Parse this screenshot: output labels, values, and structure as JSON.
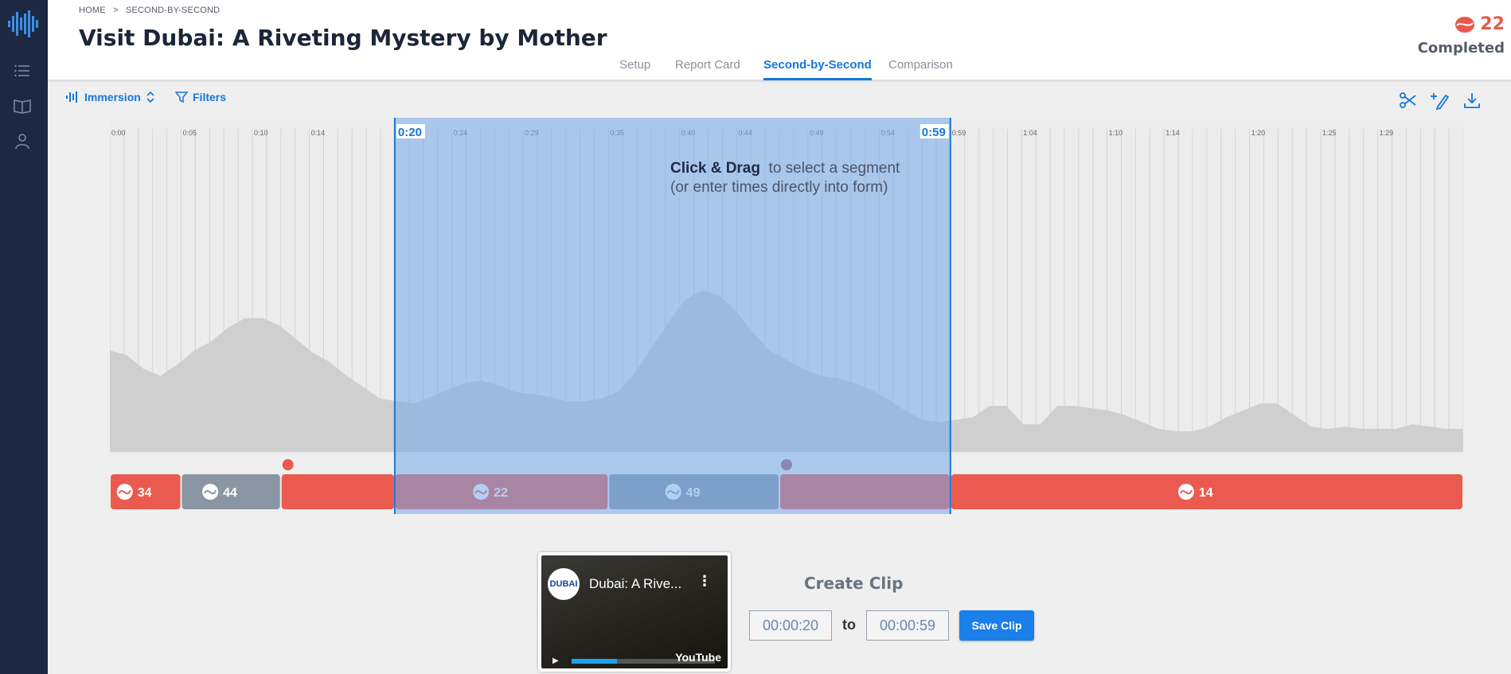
{
  "breadcrumb": {
    "home": "HOME",
    "sep": ">",
    "current": "SECOND-BY-SECOND"
  },
  "title": "Visit Dubai: A Riveting Mystery by Mother",
  "tabs": [
    {
      "label": "Setup"
    },
    {
      "label": "Report Card"
    },
    {
      "label": "Second-by-Second"
    },
    {
      "label": "Comparison"
    }
  ],
  "completed": {
    "count": "22",
    "label": "Completed"
  },
  "toolbar": {
    "mode_label": "Immersion",
    "filters_label": "Filters"
  },
  "timeline": {
    "ticks": [
      "0:00",
      "0:05",
      "0:10",
      "0:14",
      "0:20",
      "0:24",
      "0:29",
      "0:35",
      "0:40",
      "0:44",
      "0:49",
      "0:54",
      "0:59",
      "1:04",
      "1:10",
      "1:14",
      "1:20",
      "1:25",
      "1:29"
    ],
    "selection_start": "0:20",
    "selection_end": "0:59",
    "hint_bold": "Click & Drag",
    "hint_rest": "to select a segment",
    "hint_line2": "(or enter times directly into form)"
  },
  "chart_data": {
    "type": "area",
    "x_unit": "seconds",
    "xlim": [
      0,
      95
    ],
    "ylim": [
      0,
      100
    ],
    "values": [
      44,
      42,
      36,
      33,
      38,
      44,
      48,
      54,
      58,
      58,
      55,
      49,
      43,
      39,
      33,
      28,
      23,
      22,
      21,
      24,
      27,
      30,
      31,
      29,
      26,
      25,
      24,
      22,
      22,
      23,
      26,
      34,
      45,
      56,
      66,
      70,
      68,
      61,
      52,
      44,
      40,
      36,
      33,
      32,
      30,
      27,
      23,
      18,
      14,
      13,
      14,
      15,
      20,
      20,
      12,
      12,
      20,
      20,
      19,
      18,
      16,
      13,
      10,
      9,
      9,
      11,
      15,
      18,
      21,
      21,
      16,
      11,
      10,
      11,
      10,
      10,
      10,
      12,
      11,
      10,
      10
    ]
  },
  "segments": [
    {
      "label": "34",
      "color": "#eb5a4e",
      "start": 0.0,
      "end": 5.0
    },
    {
      "label": "44",
      "color": "#8a96a3",
      "start": 5.0,
      "end": 12.0
    },
    {
      "label": "",
      "color": "#eb5a4e",
      "start": 12.0,
      "end": 20.0
    },
    {
      "label": "22",
      "color": "#eb5a4e",
      "start": 20.0,
      "end": 35.0
    },
    {
      "label": "49",
      "color": "#8a96a3",
      "start": 35.0,
      "end": 47.0
    },
    {
      "label": "",
      "color": "#eb5a4e",
      "start": 47.0,
      "end": 59.0
    },
    {
      "label": "14",
      "color": "#eb5a4e",
      "start": 59.0,
      "end": 95.0
    }
  ],
  "markers": [
    {
      "t": 12.5,
      "color": "#eb5a4e"
    },
    {
      "t": 47.5,
      "color": "#a95b72"
    }
  ],
  "video": {
    "logo_text": "DUBAI",
    "title": "Dubai: A Rive...",
    "brand": "YouTube"
  },
  "clip": {
    "title": "Create Clip",
    "start_value": "00:00:20",
    "to_label": "to",
    "end_value": "00:00:59",
    "save_label": "Save Clip"
  },
  "colors": {
    "accent": "#1677d8",
    "sidebar": "#1c2940",
    "selection": "#a6c8ee",
    "coral": "#eb5a4e"
  }
}
